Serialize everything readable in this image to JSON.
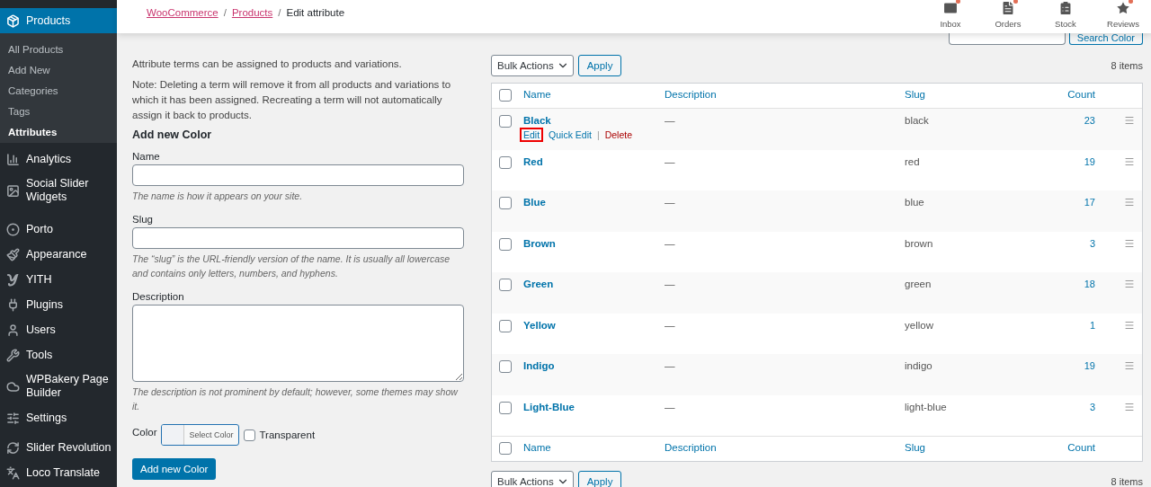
{
  "sidebar": {
    "items": [
      {
        "label": "Products",
        "selected": true,
        "children": [
          {
            "label": "All Products",
            "selected": false
          },
          {
            "label": "Add New",
            "selected": false
          },
          {
            "label": "Categories",
            "selected": false
          },
          {
            "label": "Tags",
            "selected": false
          },
          {
            "label": "Attributes",
            "selected": true
          }
        ]
      },
      {
        "label": "Analytics",
        "selected": false
      },
      {
        "label": "Social Slider Widgets",
        "selected": false
      },
      {
        "label": "Porto",
        "selected": false
      },
      {
        "label": "Appearance",
        "selected": false
      },
      {
        "label": "YITH",
        "selected": false
      },
      {
        "label": "Plugins",
        "selected": false
      },
      {
        "label": "Users",
        "selected": false
      },
      {
        "label": "Tools",
        "selected": false
      },
      {
        "label": "WPBakery Page Builder",
        "selected": false
      },
      {
        "label": "Settings",
        "selected": false
      },
      {
        "label": "Slider Revolution",
        "selected": false
      },
      {
        "label": "Loco Translate",
        "selected": false
      }
    ]
  },
  "header": {
    "breadcrumb": [
      {
        "label": "WooCommerce",
        "link": true
      },
      {
        "label": "Products",
        "link": true
      },
      {
        "label": "Edit attribute",
        "link": false
      }
    ],
    "separators": [
      "/",
      "/"
    ],
    "activity": [
      {
        "label": "Inbox",
        "notification": true
      },
      {
        "label": "Orders",
        "notification": true
      },
      {
        "label": "Stock",
        "notification": false
      },
      {
        "label": "Reviews",
        "notification": true
      }
    ]
  },
  "search": {
    "button": "Search Color"
  },
  "form": {
    "intro": "Attribute terms can be assigned to products and variations.",
    "note": "Note: Deleting a term will remove it from all products and variations to which it has been assigned. Recreating a term will not automatically assign it back to products.",
    "title": "Add new Color",
    "fields": [
      {
        "label": "Name",
        "kind": "input",
        "help": "The name is how it appears on your site."
      },
      {
        "label": "Slug",
        "kind": "input",
        "help": "The “slug” is the URL-friendly version of the name. It is usually all lowercase and contains only letters, numbers, and hyphens."
      },
      {
        "label": "Description",
        "kind": "textarea",
        "help": "The description is not prominent by default; however, some themes may show it."
      }
    ],
    "color": {
      "label": "Color",
      "picker": "Select Color",
      "transparent_label": "Transparent",
      "transparent_checked": false
    },
    "submit": "Add new Color"
  },
  "table": {
    "top_bar": {
      "bulk_actions": "Bulk Actions",
      "apply": "Apply",
      "count": "8 items"
    },
    "header_checked": false,
    "columns": [
      "Name",
      "Description",
      "Slug",
      "Count"
    ],
    "rows": [
      {
        "name": "Black",
        "description": "—",
        "slug": "black",
        "count": "23",
        "checked": false,
        "actions": [
          {
            "label": "Edit",
            "kind": "link",
            "highlighted": true
          },
          {
            "label": "Quick Edit",
            "kind": "link",
            "highlighted": false
          },
          {
            "separator": "|",
            "label": "Delete",
            "kind": "delete",
            "highlighted": false
          }
        ]
      },
      {
        "name": "Red",
        "description": "—",
        "slug": "red",
        "count": "19",
        "checked": false
      },
      {
        "name": "Blue",
        "description": "—",
        "slug": "blue",
        "count": "17",
        "checked": false
      },
      {
        "name": "Brown",
        "description": "—",
        "slug": "brown",
        "count": "3",
        "checked": false
      },
      {
        "name": "Green",
        "description": "—",
        "slug": "green",
        "count": "18",
        "checked": false
      },
      {
        "name": "Yellow",
        "description": "—",
        "slug": "yellow",
        "count": "1",
        "checked": false
      },
      {
        "name": "Indigo",
        "description": "—",
        "slug": "indigo",
        "count": "19",
        "checked": false
      },
      {
        "name": "Light-Blue",
        "description": "—",
        "slug": "light-blue",
        "count": "3",
        "checked": false
      }
    ],
    "footer_checked": false,
    "footer_columns": [
      "Name",
      "Description",
      "Slug",
      "Count"
    ],
    "bottom_bar": {
      "bulk_actions": "Bulk Actions",
      "apply": "Apply",
      "count": "8 items"
    }
  }
}
